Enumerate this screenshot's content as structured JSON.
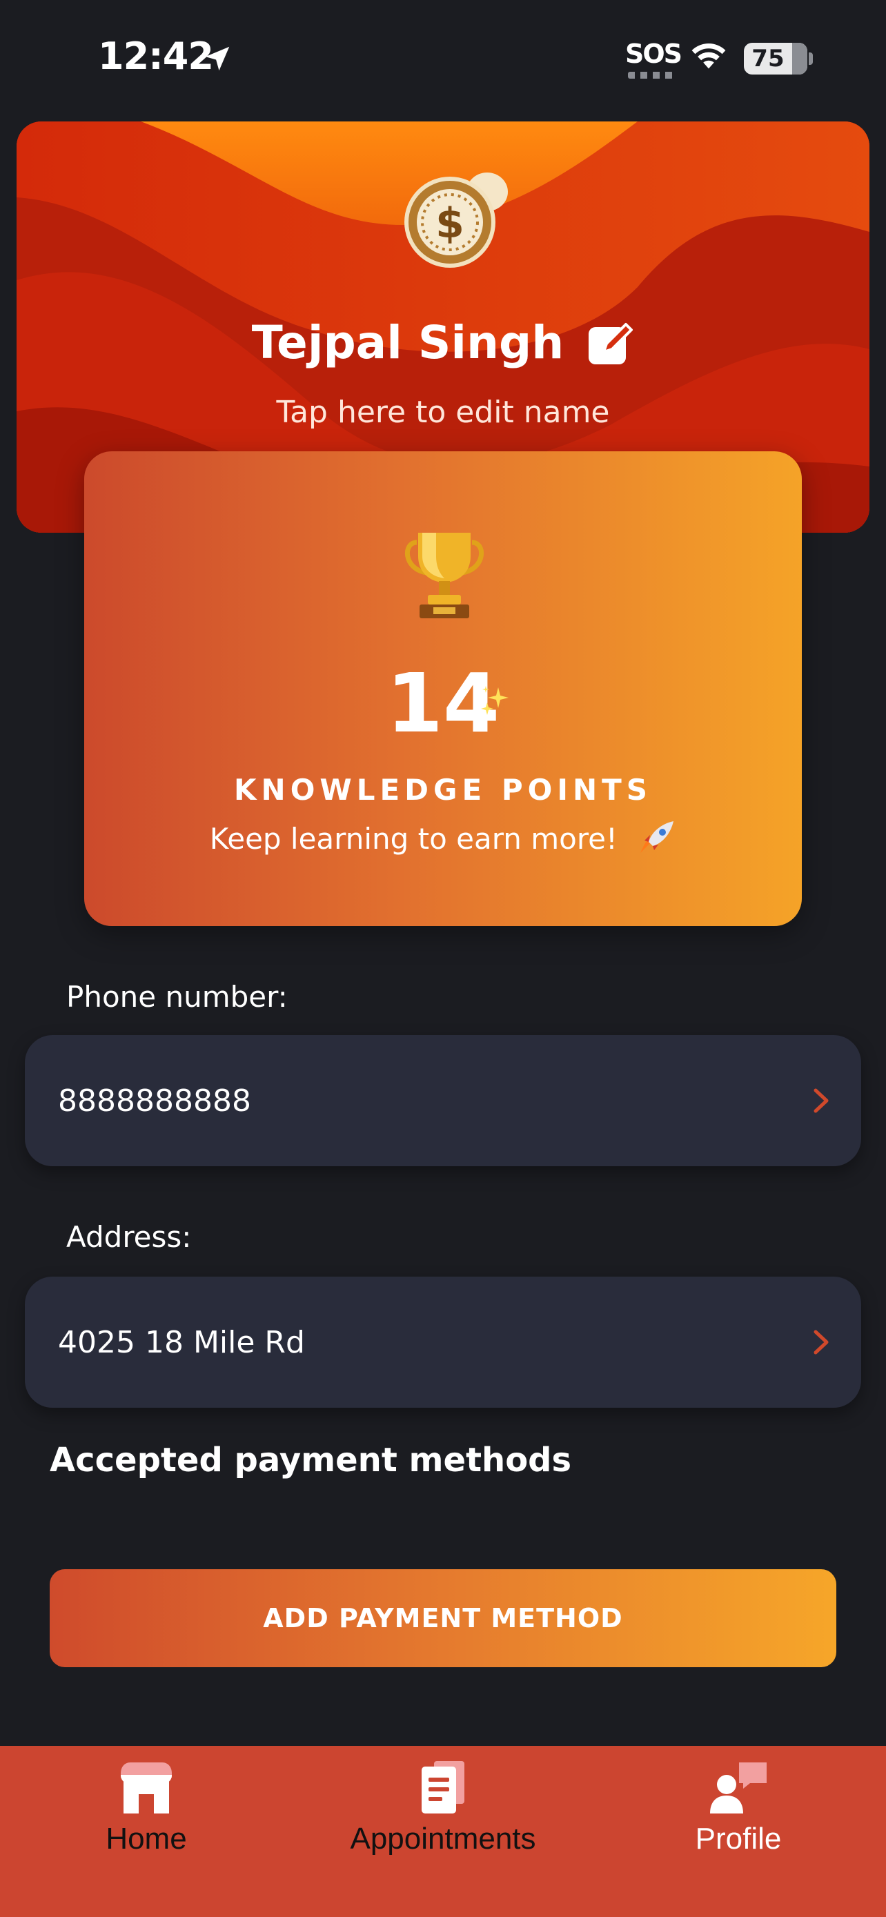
{
  "status_bar": {
    "time": "12:42",
    "sos": "SOS",
    "battery": "75",
    "battery_level": 0.75
  },
  "header": {
    "user_name": "Tejpal Singh",
    "edit_hint": "Tap here to edit name",
    "coin_icon": "dollar-coin-icon",
    "edit_icon": "edit-square-icon"
  },
  "points_card": {
    "value": "14",
    "label": "KNOWLEDGE POINTS",
    "subtitle": "Keep learning to earn more!",
    "trophy_icon": "trophy-icon",
    "sparkle_icon": "sparkle-icon",
    "rocket_icon": "rocket-icon"
  },
  "phone": {
    "label": "Phone number:",
    "value": "8888888888"
  },
  "address": {
    "label": "Address:",
    "value": "4025 18 Mile Rd"
  },
  "payments": {
    "title": "Accepted payment methods",
    "add_button": "ADD PAYMENT METHOD"
  },
  "tab_bar": {
    "tabs": [
      {
        "label": "Home",
        "icon": "store-icon",
        "active": false
      },
      {
        "label": "Appointments",
        "icon": "document-icon",
        "active": false
      },
      {
        "label": "Profile",
        "icon": "person-chat-icon",
        "active": true
      }
    ]
  },
  "colors": {
    "background": "#1b1c21",
    "card": "#292c3b",
    "accent": "#cc4530",
    "gradient_start": "#cc4a2c",
    "gradient_end": "#f5a328"
  }
}
